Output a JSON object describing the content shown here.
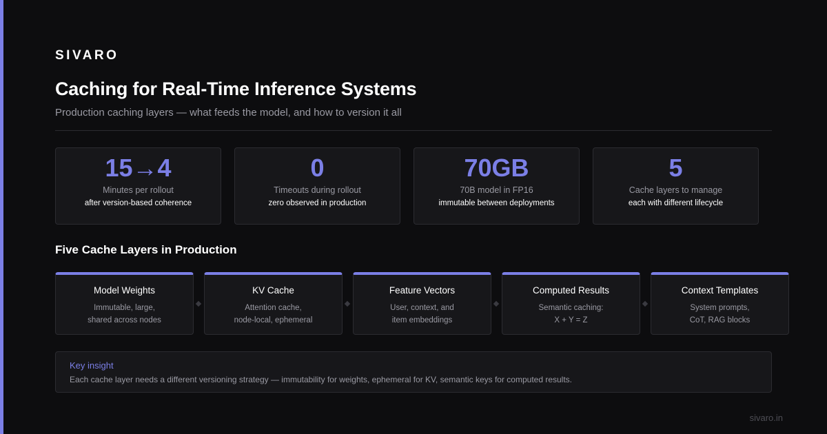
{
  "brand": "SIVARO",
  "title": "Caching for Real-Time Inference Systems",
  "subtitle": "Production caching layers — what feeds the model, and how to version it all",
  "colors": {
    "accent": "#7b7fe6",
    "background": "#0d0d0f",
    "card": "#17171a",
    "border": "#2c2c31",
    "muted_text": "#9a9aa3"
  },
  "stats": [
    {
      "value": "15→4",
      "label": "Minutes per rollout",
      "sub": "after version-based coherence"
    },
    {
      "value": "0",
      "label": "Timeouts during rollout",
      "sub": "zero observed in production"
    },
    {
      "value": "70GB",
      "label": "70B model in FP16",
      "sub": "immutable between deployments"
    },
    {
      "value": "5",
      "label": "Cache layers to manage",
      "sub": "each with different lifecycle"
    }
  ],
  "layers_section": {
    "heading": "Five Cache Layers in Production",
    "layers": [
      {
        "name": "Model Weights",
        "line1": "Immutable, large,",
        "line2": "shared across nodes"
      },
      {
        "name": "KV Cache",
        "line1": "Attention cache,",
        "line2": "node-local, ephemeral"
      },
      {
        "name": "Feature Vectors",
        "line1": "User, context, and",
        "line2": "item embeddings"
      },
      {
        "name": "Computed Results",
        "line1": "Semantic caching:",
        "line2": "X + Y = Z"
      },
      {
        "name": "Context Templates",
        "line1": "System prompts,",
        "line2": "CoT, RAG blocks"
      }
    ]
  },
  "insight": {
    "heading": "Key insight",
    "text": "Each cache layer needs a different versioning strategy — immutability for weights, ephemeral for KV, semantic keys for computed results."
  },
  "footer": "sivaro.in"
}
